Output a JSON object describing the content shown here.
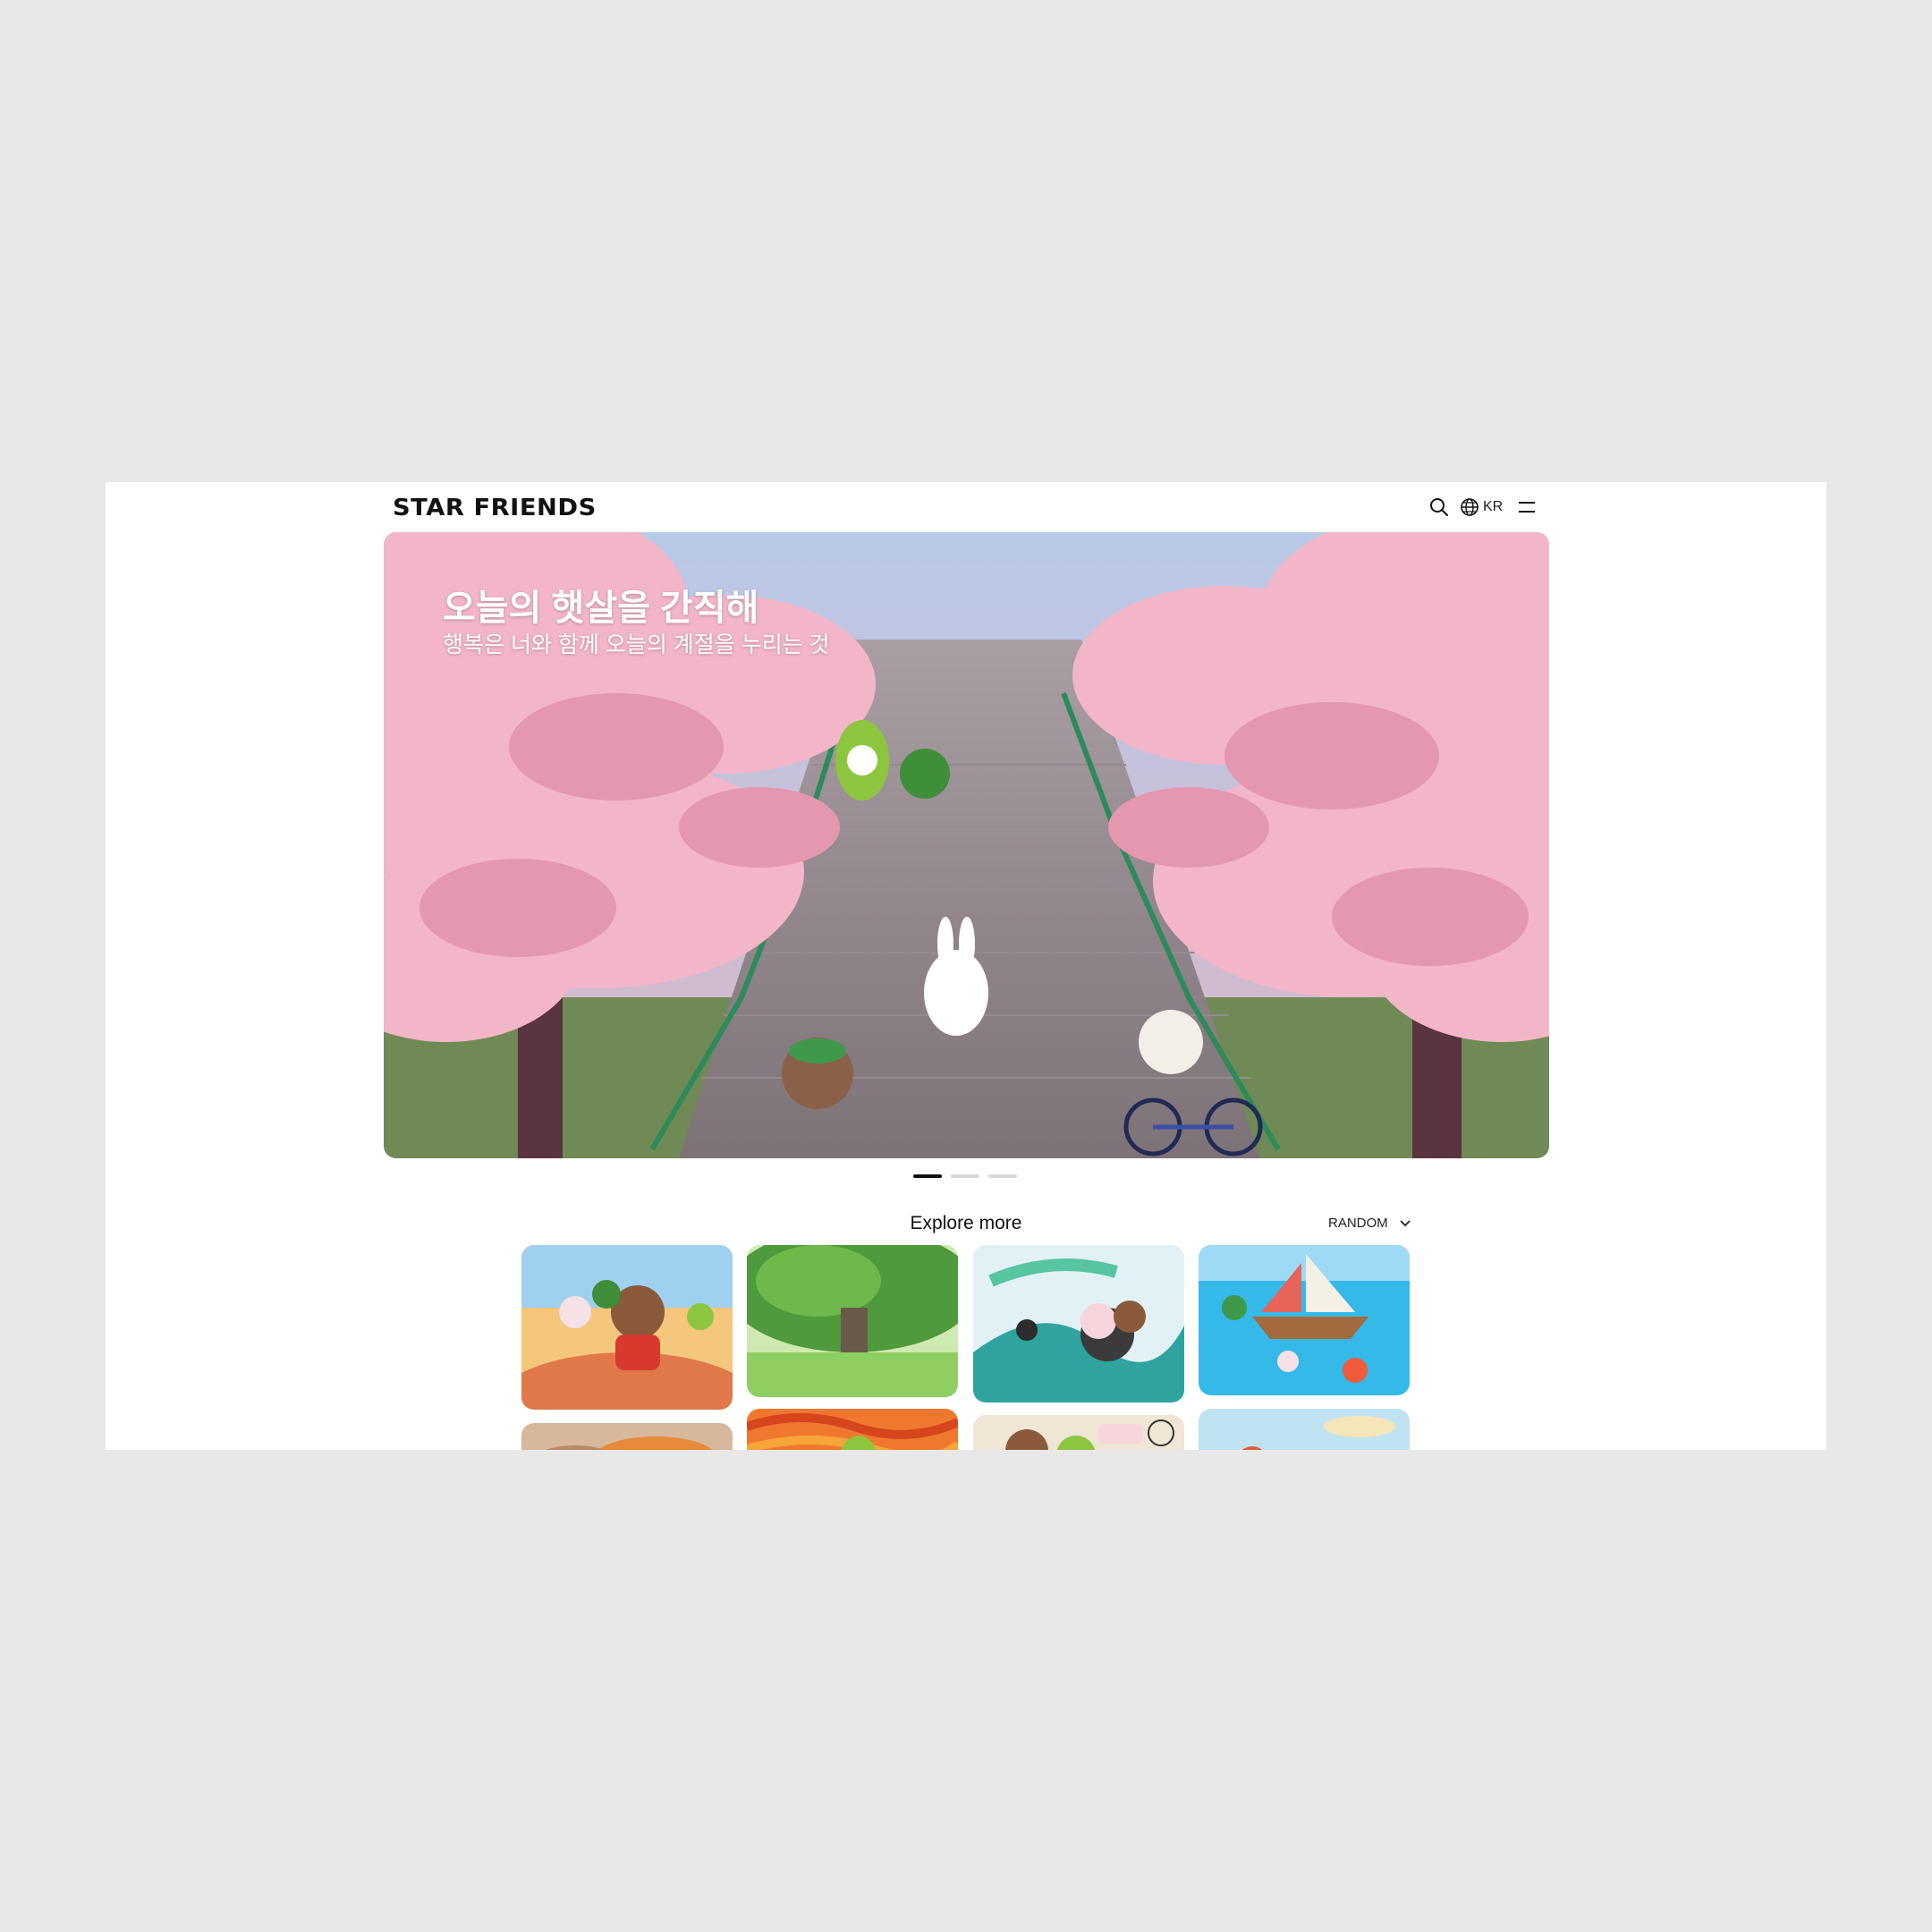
{
  "header": {
    "logo": "STAR FRIENDS",
    "search_icon": "search-icon",
    "language": "KR",
    "language_icon": "globe-icon",
    "menu_icon": "menu-icon"
  },
  "hero": {
    "title": "오늘의 햇살을 간직해",
    "subtitle": "행복은 너와 함께 오늘의 계절을 누리는 것",
    "slide_count": 3,
    "active_slide": 1
  },
  "explore": {
    "title": "Explore more",
    "sort_label": "RANDOM",
    "sort_icon": "chevron-down-icon"
  },
  "colors": {
    "background": "#e8e8e8",
    "page": "#ffffff",
    "active_dot": "#111111",
    "inactive_dot": "#d9d9d9",
    "blossom": "#f2b6c8"
  }
}
